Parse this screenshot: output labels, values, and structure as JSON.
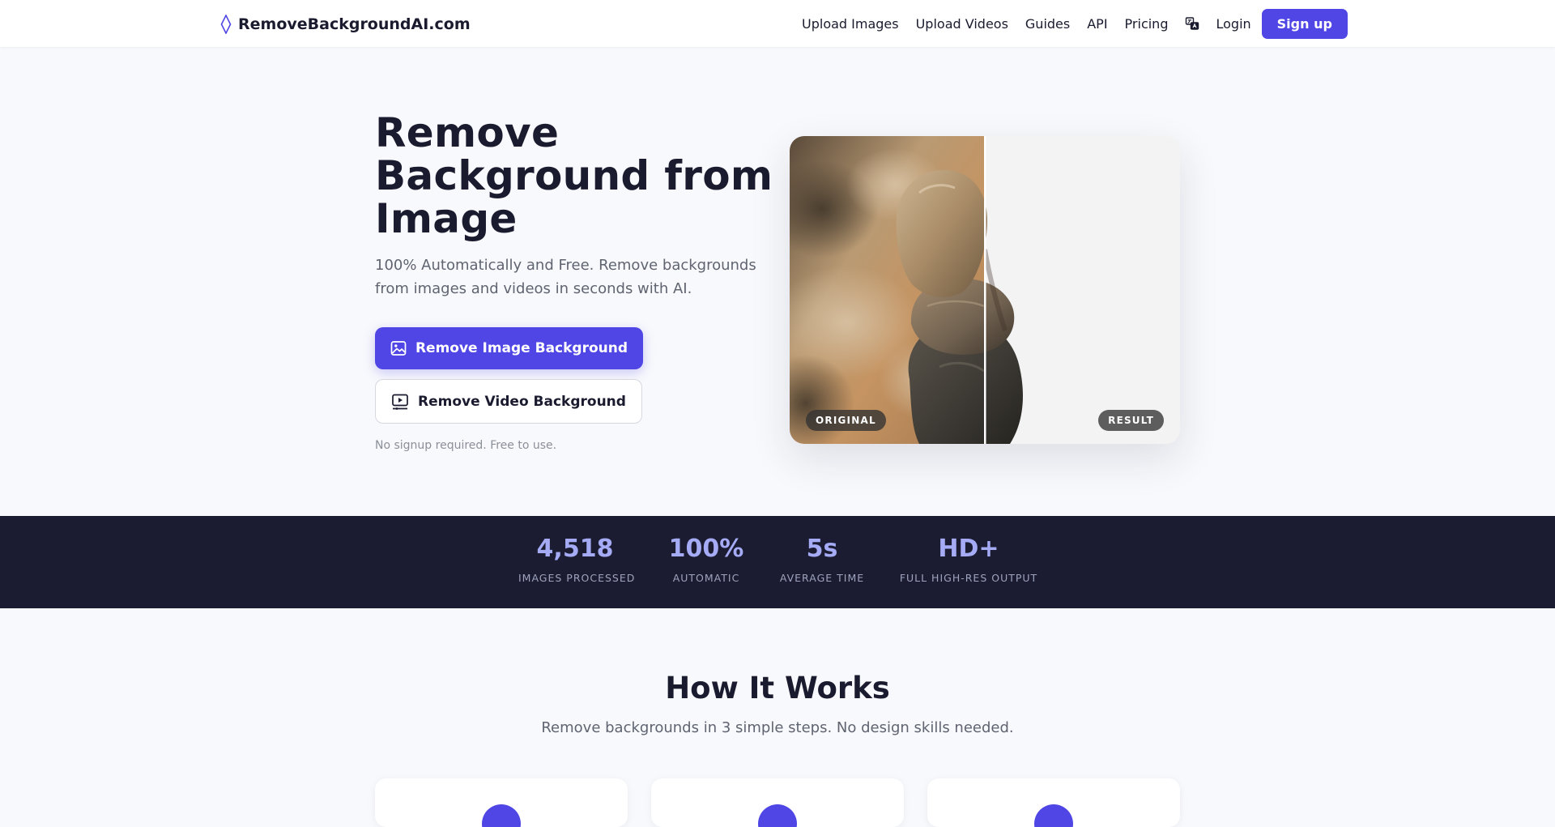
{
  "nav": {
    "brand": "RemoveBackgroundAI.com",
    "links": [
      "Upload Images",
      "Upload Videos",
      "Guides",
      "API",
      "Pricing"
    ],
    "language_icon": "translate-icon",
    "login": "Login",
    "signup": "Sign up"
  },
  "hero": {
    "title": "Remove Background from Image",
    "subtitle": "100% Automatically and Free. Remove backgrounds from images and videos in seconds with AI.",
    "primary_button": "Remove Image Background",
    "primary_button_icon": "image-icon",
    "secondary_button": "Remove Video Background",
    "secondary_button_icon": "video-icon",
    "note": "No signup required. Free to use."
  },
  "comparison": {
    "left_label": "ORIGINAL",
    "right_label": "RESULT"
  },
  "stats": [
    {
      "value": "4,518",
      "label": "IMAGES PROCESSED"
    },
    {
      "value": "100%",
      "label": "AUTOMATIC"
    },
    {
      "value": "5s",
      "label": "AVERAGE TIME"
    },
    {
      "value": "HD+",
      "label": "FULL HIGH-RES OUTPUT"
    }
  ],
  "how": {
    "title": "How It Works",
    "subtitle": "Remove backgrounds in 3 simple steps. No design skills needed."
  },
  "colors": {
    "accent": "#4f46e5",
    "stats_band": "#1b1c31",
    "stat_value": "#a5acf5"
  }
}
